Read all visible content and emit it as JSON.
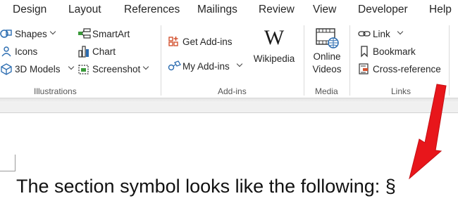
{
  "menu": {
    "tabs": [
      "Design",
      "Layout",
      "References",
      "Mailings",
      "Review",
      "View",
      "Developer",
      "Help"
    ]
  },
  "ribbon": {
    "illustrations": {
      "shapes": "Shapes",
      "icons": "Icons",
      "models": "3D Models",
      "smartart": "SmartArt",
      "chart": "Chart",
      "screenshot": "Screenshot",
      "label": "Illustrations"
    },
    "addins": {
      "get": "Get Add-ins",
      "my": "My Add-ins",
      "wikipedia": "Wikipedia",
      "label": "Add-ins"
    },
    "media": {
      "online_line1": "Online",
      "online_line2": "Videos",
      "label": "Media"
    },
    "links": {
      "link": "Link",
      "bookmark": "Bookmark",
      "crossref": "Cross-reference",
      "label": "Links"
    }
  },
  "document": {
    "text": "The section symbol looks like the following: §"
  },
  "colors": {
    "accent_orange": "#d35230",
    "accent_blue": "#2b6cb0",
    "arrow_red": "#e8161b"
  }
}
